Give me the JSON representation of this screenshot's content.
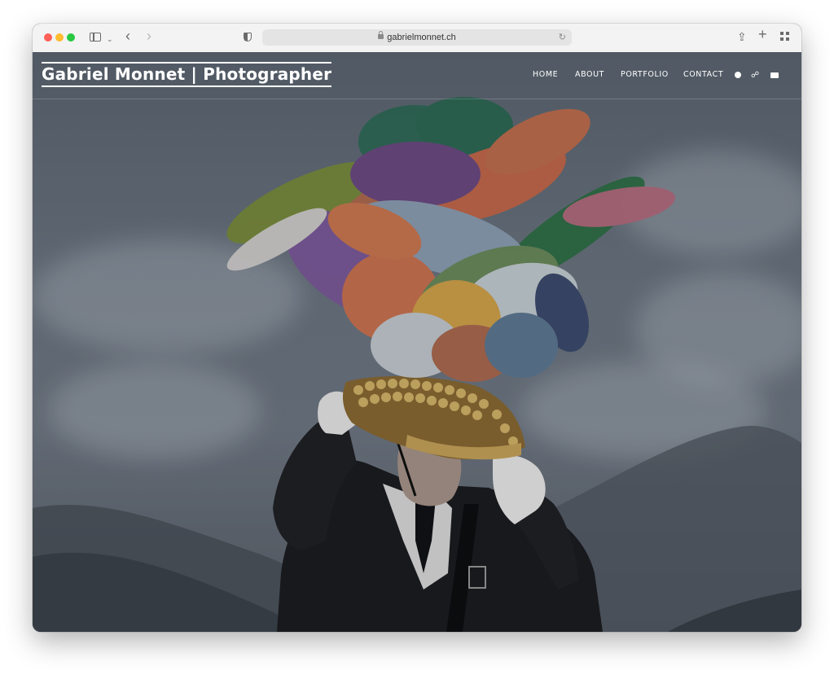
{
  "browser": {
    "url": "gabrielmonnet.ch"
  },
  "site": {
    "title": "Gabriel Monnet | Photographer",
    "nav": [
      {
        "label": "HOME"
      },
      {
        "label": "ABOUT"
      },
      {
        "label": "PORTFOLIO"
      },
      {
        "label": "CONTACT"
      }
    ],
    "icons": [
      "globe-icon",
      "share-icon",
      "mail-icon"
    ]
  },
  "hero": {
    "subject": "man-with-feather-headdress"
  },
  "colors": {
    "overlay": "#5c6672",
    "text": "#ffffff"
  }
}
